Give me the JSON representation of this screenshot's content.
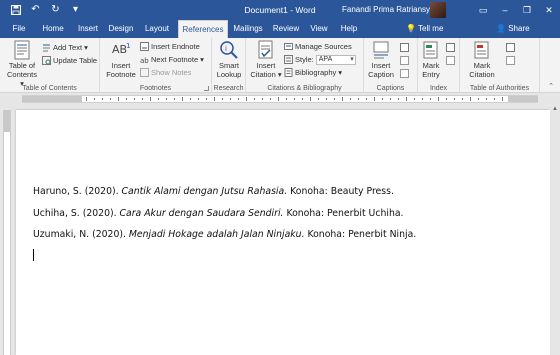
{
  "titlebar": {
    "doc_title": "Document1 - Word",
    "user": "Fanandi Prima Ratriansyah",
    "save_icon": "save-icon",
    "undo_icon": "undo-icon",
    "redo_icon": "redo-icon",
    "customize_icon": "customize-quick-access-icon"
  },
  "tabs": [
    "File",
    "Home",
    "Insert",
    "Design",
    "Layout",
    "References",
    "Mailings",
    "Review",
    "View",
    "Help"
  ],
  "active_tab": "References",
  "tell_me": "Tell me",
  "share": "Share",
  "ribbon": {
    "toc": {
      "table_of_contents": "Table of Contents",
      "add_text": "Add Text",
      "update_table": "Update Table",
      "group": "Table of Contents"
    },
    "footnotes": {
      "insert_footnote": "Insert Footnote",
      "insert_endnote": "Insert Endnote",
      "next_footnote": "Next Footnote",
      "show_notes": "Show Notes",
      "group": "Footnotes"
    },
    "research": {
      "smart_lookup": "Smart Lookup",
      "group": "Research"
    },
    "citations": {
      "insert_citation": "Insert Citation",
      "manage_sources": "Manage Sources",
      "style_label": "Style:",
      "style_value": "APA",
      "bibliography": "Bibliography",
      "group": "Citations & Bibliography"
    },
    "captions": {
      "insert_caption": "Insert Caption",
      "group": "Captions"
    },
    "index": {
      "mark_entry": "Mark Entry",
      "group": "Index"
    },
    "authorities": {
      "mark_citation": "Mark Citation",
      "group": "Table of Authorities"
    }
  },
  "document": {
    "references": [
      {
        "before": "Haruno, S. (2020). ",
        "title": "Cantik Alami dengan Jutsu Rahasia.",
        "after": " Konoha: Beauty Press."
      },
      {
        "before": "Uchiha, S. (2020). ",
        "title": "Cara Akur dengan Saudara Sendiri.",
        "after": " Konoha: Penerbit Uchiha."
      },
      {
        "before": "Uzumaki, N. (2020). ",
        "title": "Menjadi Hokage adalah Jalan Ninjaku.",
        "after": " Konoha: Penerbit Ninja."
      }
    ]
  },
  "colors": {
    "brand": "#2b579a",
    "ribbon_bg": "#f3f3f3"
  }
}
